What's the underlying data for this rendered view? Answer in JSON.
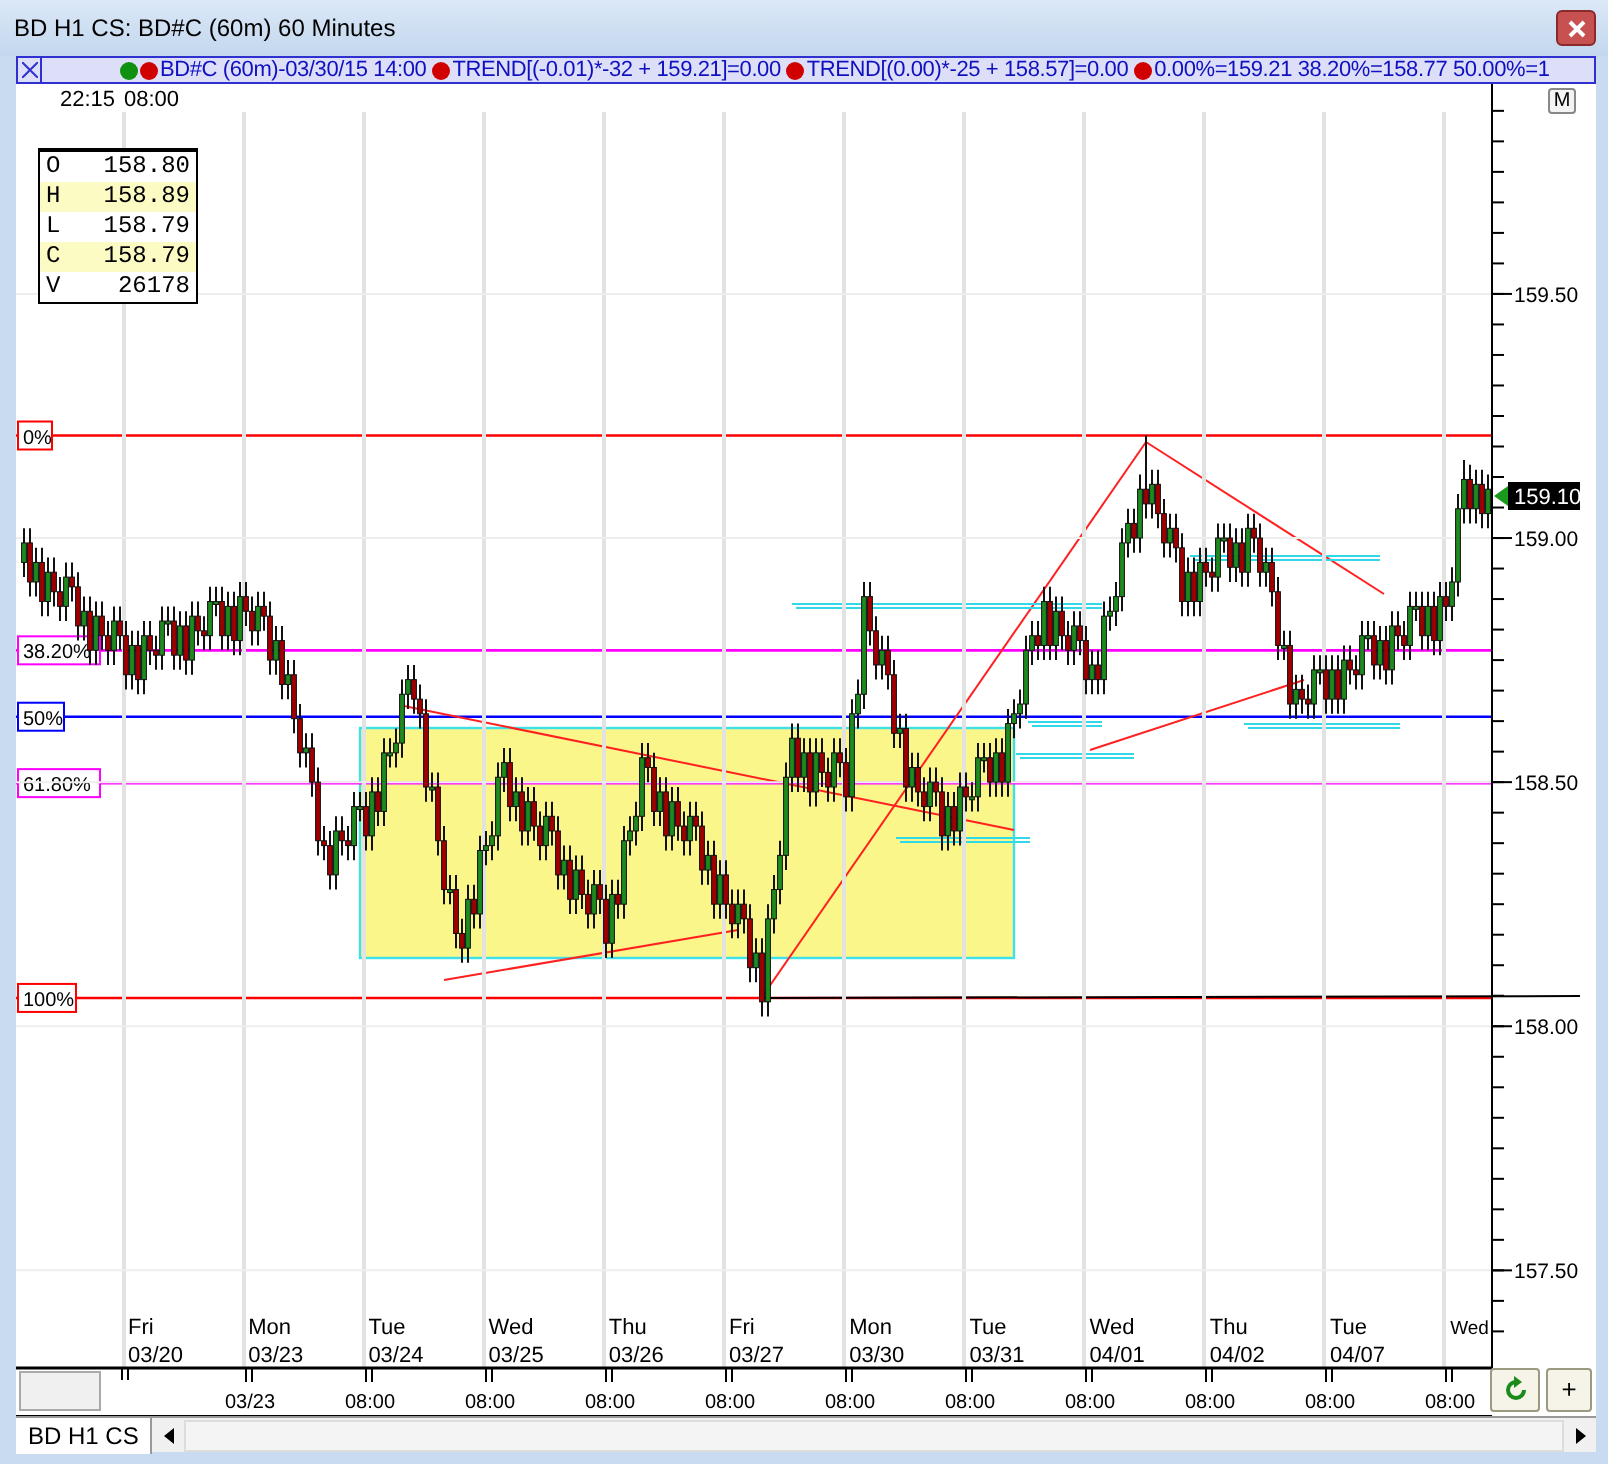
{
  "window": {
    "title": "BD H1 CS: BD#C (60m) 60 Minutes"
  },
  "legend": [
    {
      "kind": "symbol",
      "text": "BD#C (60m)-03/30/15 14:00"
    },
    {
      "kind": "study",
      "text": "TREND[(-0.01)*-32 + 159.21]=0.00"
    },
    {
      "kind": "study",
      "text": "TREND[(0.00)*-25 + 158.57]=0.00"
    },
    {
      "kind": "study",
      "text": "0.00%=159.21 38.20%=158.77 50.00%=1"
    }
  ],
  "time_header": [
    "22:15",
    "08:00"
  ],
  "fib_levels": [
    {
      "label": "0%",
      "color": "#ff0000"
    },
    {
      "label": "38.20%",
      "color": "#ff00ff"
    },
    {
      "label": "50%",
      "color": "#0000ff"
    },
    {
      "label": "61.80%",
      "color": "#ff00ff"
    },
    {
      "label": "100%",
      "color": "#ff0000"
    }
  ],
  "corner_button": "M",
  "ohlc": [
    {
      "label": "O",
      "value": "158.80",
      "highlighted": false
    },
    {
      "label": "H",
      "value": "158.89",
      "highlighted": true
    },
    {
      "label": "L",
      "value": "158.79",
      "highlighted": false
    },
    {
      "label": "C",
      "value": "158.79",
      "highlighted": true
    },
    {
      "label": "V",
      "value": "26178",
      "highlighted": false
    }
  ],
  "last_price": "159.10",
  "date_labels": [
    {
      "day": "Fri",
      "date": "03/20"
    },
    {
      "day": "Mon",
      "date": "03/23"
    },
    {
      "day": "Tue",
      "date": "03/24"
    },
    {
      "day": "Wed",
      "date": "03/25"
    },
    {
      "day": "Thu",
      "date": "03/26"
    },
    {
      "day": "Fri",
      "date": "03/27"
    },
    {
      "day": "Mon",
      "date": "03/30"
    },
    {
      "day": "Tue",
      "date": "03/31"
    },
    {
      "day": "Wed",
      "date": "04/01"
    },
    {
      "day": "Thu",
      "date": "04/02"
    },
    {
      "day": "Tue",
      "date": "04/07"
    },
    {
      "day": "Wed"
    }
  ],
  "time_axis": [
    "03/23",
    "08:00",
    "08:00",
    "08:00",
    "08:00",
    "08:00",
    "08:00",
    "08:00",
    "08:00",
    "08:00",
    "08:00"
  ],
  "chart": {
    "chart_data": {
      "type": "candlestick",
      "ylim": [
        157.3,
        159.93
      ],
      "grid": true,
      "yticks": [
        {
          "value": 159.5,
          "label": "159.50"
        },
        {
          "value": 159.0,
          "label": "159.00"
        },
        {
          "value": 158.5,
          "label": "158.50"
        },
        {
          "value": 158.0,
          "label": "158.00"
        },
        {
          "value": 157.5,
          "label": "157.50"
        }
      ],
      "categories": [
        null,
        null,
        null,
        null,
        null,
        null,
        null,
        null,
        null,
        null,
        null,
        null,
        null,
        null,
        null,
        null,
        null,
        null,
        null,
        null,
        null,
        null,
        null,
        null,
        null,
        null,
        null,
        null,
        null,
        null,
        null,
        null,
        null,
        null,
        null,
        null,
        null,
        null,
        null,
        null,
        null,
        null,
        null,
        null,
        null,
        null,
        null,
        null,
        null,
        null,
        null,
        null,
        null,
        null,
        null,
        null,
        null,
        null,
        null,
        null,
        null,
        null,
        null,
        null,
        null,
        null,
        null,
        null,
        null,
        null,
        null,
        null,
        null,
        null,
        null,
        null,
        null,
        null,
        null,
        null,
        null,
        null,
        null,
        null,
        null,
        null,
        null,
        null,
        null,
        null,
        null,
        null,
        null,
        null,
        null,
        null,
        null,
        null,
        null,
        null,
        null,
        null,
        null,
        null,
        null,
        null,
        null,
        null,
        null,
        null,
        null,
        null,
        null,
        null,
        null,
        null,
        null,
        null,
        null,
        null,
        null,
        null,
        null,
        null,
        null,
        null,
        null,
        null,
        null,
        null,
        null,
        null,
        null,
        null,
        null,
        null,
        null,
        null,
        null,
        null,
        null,
        null,
        null,
        null,
        null,
        null,
        null,
        null,
        null,
        null,
        null,
        null,
        null,
        null,
        null,
        null,
        null,
        null,
        null,
        null,
        null,
        null,
        null,
        null,
        null,
        null,
        null,
        null,
        null,
        null,
        null,
        null,
        null,
        null,
        null,
        null,
        null,
        null,
        null,
        null,
        null,
        null,
        null,
        null,
        null,
        null,
        null,
        null,
        null,
        null,
        null,
        null,
        null,
        null,
        null,
        null,
        null,
        null,
        null,
        null,
        null,
        null,
        null,
        null,
        null,
        null,
        null,
        null,
        null,
        null,
        null,
        null,
        null,
        null,
        null,
        null,
        null,
        null,
        null,
        null,
        null,
        null,
        null,
        null,
        null,
        null,
        null,
        null,
        null,
        null,
        null,
        null,
        null,
        null,
        null,
        null,
        null,
        null,
        null,
        null,
        null,
        null,
        null,
        null,
        null
      ],
      "ohlc": [
        [
          158.95,
          159.02,
          158.92,
          158.99
        ],
        [
          158.99,
          159.02,
          158.88,
          158.91
        ],
        [
          158.91,
          158.98,
          158.88,
          158.95
        ],
        [
          158.95,
          158.98,
          158.84,
          158.87
        ],
        [
          158.87,
          158.96,
          158.84,
          158.93
        ],
        [
          158.93,
          158.96,
          158.86,
          158.89
        ],
        [
          158.89,
          158.92,
          158.83,
          158.86
        ],
        [
          158.86,
          158.95,
          158.83,
          158.92
        ],
        [
          158.92,
          158.95,
          158.87,
          158.9
        ],
        [
          158.9,
          158.93,
          158.79,
          158.82
        ],
        [
          158.82,
          158.88,
          158.79,
          158.85
        ],
        [
          158.85,
          158.88,
          158.74,
          158.77
        ],
        [
          158.77,
          158.87,
          158.74,
          158.84
        ],
        [
          158.84,
          158.87,
          158.77,
          158.8
        ],
        [
          158.8,
          158.83,
          158.74,
          158.77
        ],
        [
          158.77,
          158.86,
          158.74,
          158.83
        ],
        [
          158.83,
          158.86,
          158.77,
          158.8
        ],
        [
          158.8,
          158.83,
          158.69,
          158.72
        ],
        [
          158.72,
          158.81,
          158.69,
          158.78
        ],
        [
          158.78,
          158.81,
          158.68,
          158.71
        ],
        [
          158.71,
          158.83,
          158.68,
          158.8
        ],
        [
          158.8,
          158.83,
          158.74,
          158.77
        ],
        [
          158.77,
          158.8,
          158.73,
          158.76
        ],
        [
          158.76,
          158.86,
          158.73,
          158.83
        ],
        [
          158.83,
          158.86,
          158.8,
          158.83
        ],
        [
          158.83,
          158.86,
          158.73,
          158.76
        ],
        [
          158.76,
          158.85,
          158.73,
          158.82
        ],
        [
          158.82,
          158.85,
          158.72,
          158.75
        ],
        [
          158.75,
          158.87,
          158.72,
          158.84
        ],
        [
          158.84,
          158.87,
          158.78,
          158.81
        ],
        [
          158.81,
          158.84,
          158.77,
          158.8
        ],
        [
          158.8,
          158.9,
          158.77,
          158.87
        ],
        [
          158.87,
          158.9,
          158.84,
          158.87
        ],
        [
          158.87,
          158.9,
          158.77,
          158.8
        ],
        [
          158.8,
          158.89,
          158.77,
          158.86
        ],
        [
          158.86,
          158.89,
          158.76,
          158.79
        ],
        [
          158.79,
          158.91,
          158.76,
          158.88
        ],
        [
          158.88,
          158.91,
          158.82,
          158.85
        ],
        [
          158.85,
          158.88,
          158.78,
          158.81
        ],
        [
          158.81,
          158.89,
          158.78,
          158.86
        ],
        [
          158.86,
          158.89,
          158.81,
          158.84
        ],
        [
          158.84,
          158.87,
          158.72,
          158.75
        ],
        [
          158.75,
          158.82,
          158.72,
          158.79
        ],
        [
          158.79,
          158.82,
          158.67,
          158.7
        ],
        [
          158.7,
          158.75,
          158.67,
          158.72
        ],
        [
          158.72,
          158.75,
          158.6,
          158.63
        ],
        [
          158.63,
          158.66,
          158.53,
          158.56
        ],
        [
          158.56,
          158.6,
          158.53,
          158.57
        ],
        [
          158.57,
          158.6,
          158.47,
          158.5
        ],
        [
          158.5,
          158.53,
          158.35,
          158.38
        ],
        [
          158.38,
          158.41,
          158.34,
          158.37
        ],
        [
          158.37,
          158.4,
          158.28,
          158.31
        ],
        [
          158.31,
          158.43,
          158.28,
          158.4
        ],
        [
          158.4,
          158.43,
          158.35,
          158.38
        ],
        [
          158.38,
          158.41,
          158.34,
          158.37
        ],
        [
          158.37,
          158.48,
          158.34,
          158.45
        ],
        [
          158.45,
          158.48,
          158.42,
          158.45
        ],
        [
          158.45,
          158.48,
          158.36,
          158.39
        ],
        [
          158.39,
          158.51,
          158.36,
          158.48
        ],
        [
          158.48,
          158.51,
          158.41,
          158.44
        ],
        [
          158.44,
          158.59,
          158.41,
          158.56
        ],
        [
          158.56,
          158.59,
          158.53,
          158.56
        ],
        [
          158.56,
          158.61,
          158.53,
          158.58
        ],
        [
          158.58,
          158.71,
          158.55,
          158.68
        ],
        [
          158.68,
          158.74,
          158.65,
          158.71
        ],
        [
          158.71,
          158.74,
          158.64,
          158.67
        ],
        [
          158.67,
          158.7,
          158.61,
          158.64
        ],
        [
          158.64,
          158.67,
          158.46,
          158.49
        ],
        [
          158.49,
          158.52,
          158.46,
          158.49
        ],
        [
          158.49,
          158.52,
          158.35,
          158.38
        ],
        [
          158.38,
          158.41,
          158.25,
          158.28
        ],
        [
          158.28,
          158.31,
          158.25,
          158.28
        ],
        [
          158.28,
          158.31,
          158.16,
          158.19
        ],
        [
          158.19,
          158.22,
          158.13,
          158.16
        ],
        [
          158.16,
          158.29,
          158.13,
          158.26
        ],
        [
          158.26,
          158.29,
          158.2,
          158.23
        ],
        [
          158.23,
          158.39,
          158.2,
          158.36
        ],
        [
          158.36,
          158.4,
          158.33,
          158.37
        ],
        [
          158.37,
          158.42,
          158.34,
          158.39
        ],
        [
          158.39,
          158.54,
          158.36,
          158.51
        ],
        [
          158.51,
          158.57,
          158.48,
          158.54
        ],
        [
          158.54,
          158.57,
          158.42,
          158.45
        ],
        [
          158.45,
          158.51,
          158.42,
          158.48
        ],
        [
          158.48,
          158.51,
          158.37,
          158.4
        ],
        [
          158.4,
          158.49,
          158.37,
          158.46
        ],
        [
          158.46,
          158.49,
          158.38,
          158.41
        ],
        [
          158.41,
          158.44,
          158.34,
          158.37
        ],
        [
          158.37,
          158.46,
          158.34,
          158.43
        ],
        [
          158.43,
          158.46,
          158.37,
          158.4
        ],
        [
          158.4,
          158.43,
          158.28,
          158.31
        ],
        [
          158.31,
          158.37,
          158.28,
          158.34
        ],
        [
          158.34,
          158.37,
          158.23,
          158.26
        ],
        [
          158.26,
          158.35,
          158.23,
          158.32
        ],
        [
          158.32,
          158.35,
          158.24,
          158.27
        ],
        [
          158.27,
          158.3,
          158.2,
          158.23
        ],
        [
          158.23,
          158.32,
          158.2,
          158.29
        ],
        [
          158.29,
          158.32,
          158.23,
          158.26
        ],
        [
          158.26,
          158.29,
          158.14,
          158.17
        ],
        [
          158.17,
          158.3,
          158.14,
          158.27
        ],
        [
          158.27,
          158.3,
          158.22,
          158.25
        ],
        [
          158.25,
          158.41,
          158.22,
          158.38
        ],
        [
          158.38,
          158.43,
          158.35,
          158.4
        ],
        [
          158.4,
          158.46,
          158.37,
          158.43
        ],
        [
          158.43,
          158.58,
          158.4,
          158.55
        ],
        [
          158.55,
          158.58,
          158.5,
          158.53
        ],
        [
          158.53,
          158.56,
          158.41,
          158.44
        ],
        [
          158.44,
          158.51,
          158.41,
          158.48
        ],
        [
          158.48,
          158.51,
          158.36,
          158.39
        ],
        [
          158.39,
          158.49,
          158.36,
          158.46
        ],
        [
          158.46,
          158.49,
          158.38,
          158.41
        ],
        [
          158.41,
          158.44,
          158.35,
          158.38
        ],
        [
          158.38,
          158.46,
          158.35,
          158.43
        ],
        [
          158.43,
          158.46,
          158.38,
          158.41
        ],
        [
          158.41,
          158.44,
          158.29,
          158.32
        ],
        [
          158.32,
          158.38,
          158.29,
          158.35
        ],
        [
          158.35,
          158.38,
          158.22,
          158.25
        ],
        [
          158.25,
          158.34,
          158.22,
          158.31
        ],
        [
          158.31,
          158.34,
          158.22,
          158.25
        ],
        [
          158.25,
          158.28,
          158.18,
          158.21
        ],
        [
          158.21,
          158.28,
          158.18,
          158.25
        ],
        [
          158.25,
          158.28,
          158.19,
          158.22
        ],
        [
          158.22,
          158.25,
          158.09,
          158.12
        ],
        [
          158.12,
          158.18,
          158.09,
          158.15
        ],
        [
          158.15,
          158.18,
          158.02,
          158.05
        ],
        [
          158.05,
          158.25,
          158.02,
          158.22
        ],
        [
          158.22,
          158.31,
          158.19,
          158.28
        ],
        [
          158.28,
          158.38,
          158.25,
          158.35
        ],
        [
          158.35,
          158.54,
          158.32,
          158.51
        ],
        [
          158.51,
          158.62,
          158.48,
          158.59
        ],
        [
          158.59,
          158.62,
          158.48,
          158.51
        ],
        [
          158.51,
          158.59,
          158.48,
          158.56
        ],
        [
          158.56,
          158.59,
          158.45,
          158.48
        ],
        [
          158.48,
          158.59,
          158.45,
          158.56
        ],
        [
          158.56,
          158.59,
          158.49,
          158.52
        ],
        [
          158.52,
          158.55,
          158.46,
          158.49
        ],
        [
          158.49,
          158.59,
          158.46,
          158.56
        ],
        [
          158.56,
          158.59,
          158.51,
          158.54
        ],
        [
          158.54,
          158.57,
          158.44,
          158.47
        ],
        [
          158.47,
          158.67,
          158.44,
          158.64
        ],
        [
          158.64,
          158.71,
          158.61,
          158.68
        ],
        [
          158.68,
          158.91,
          158.65,
          158.88
        ],
        [
          158.88,
          158.91,
          158.78,
          158.81
        ],
        [
          158.81,
          158.84,
          158.71,
          158.74
        ],
        [
          158.74,
          158.8,
          158.71,
          158.77
        ],
        [
          158.77,
          158.8,
          158.69,
          158.72
        ],
        [
          158.72,
          158.75,
          158.57,
          158.6
        ],
        [
          158.6,
          158.64,
          158.57,
          158.61
        ],
        [
          158.61,
          158.64,
          158.46,
          158.49
        ],
        [
          158.49,
          158.56,
          158.46,
          158.53
        ],
        [
          158.53,
          158.56,
          158.45,
          158.48
        ],
        [
          158.48,
          158.51,
          158.42,
          158.45
        ],
        [
          158.45,
          158.53,
          158.42,
          158.5
        ],
        [
          158.5,
          158.53,
          158.45,
          158.48
        ],
        [
          158.48,
          158.51,
          158.36,
          158.39
        ],
        [
          158.39,
          158.48,
          158.36,
          158.45
        ],
        [
          158.45,
          158.48,
          158.37,
          158.4
        ],
        [
          158.4,
          158.52,
          158.37,
          158.49
        ],
        [
          158.49,
          158.52,
          158.44,
          158.47
        ],
        [
          158.47,
          158.5,
          158.44,
          158.47
        ],
        [
          158.47,
          158.58,
          158.44,
          158.55
        ],
        [
          158.55,
          158.58,
          158.52,
          158.55
        ],
        [
          158.55,
          158.58,
          158.47,
          158.5
        ],
        [
          158.5,
          158.59,
          158.47,
          158.56
        ],
        [
          158.56,
          158.59,
          158.47,
          158.5
        ],
        [
          158.5,
          158.65,
          158.47,
          158.62
        ],
        [
          158.62,
          158.67,
          158.59,
          158.64
        ],
        [
          158.64,
          158.69,
          158.61,
          158.66
        ],
        [
          158.66,
          158.8,
          158.63,
          158.77
        ],
        [
          158.77,
          158.83,
          158.74,
          158.8
        ],
        [
          158.8,
          158.83,
          158.75,
          158.78
        ],
        [
          158.78,
          158.9,
          158.75,
          158.87
        ],
        [
          158.87,
          158.9,
          158.75,
          158.78
        ],
        [
          158.78,
          158.88,
          158.75,
          158.85
        ],
        [
          158.85,
          158.88,
          158.77,
          158.8
        ],
        [
          158.8,
          158.83,
          158.74,
          158.77
        ],
        [
          158.77,
          158.85,
          158.74,
          158.82
        ],
        [
          158.82,
          158.85,
          158.76,
          158.79
        ],
        [
          158.79,
          158.82,
          158.68,
          158.71
        ],
        [
          158.71,
          158.77,
          158.68,
          158.74
        ],
        [
          158.74,
          158.77,
          158.68,
          158.71
        ],
        [
          158.71,
          158.87,
          158.68,
          158.84
        ],
        [
          158.84,
          158.88,
          158.81,
          158.85
        ],
        [
          158.85,
          158.91,
          158.82,
          158.88
        ],
        [
          158.88,
          159.02,
          158.85,
          158.99
        ],
        [
          158.99,
          159.06,
          158.96,
          159.03
        ],
        [
          159.03,
          159.06,
          158.97,
          159.0
        ],
        [
          159.0,
          159.13,
          158.97,
          159.1
        ],
        [
          159.1,
          159.21,
          159.04,
          159.07
        ],
        [
          159.07,
          159.14,
          159.04,
          159.11
        ],
        [
          159.11,
          159.14,
          159.02,
          159.05
        ],
        [
          159.05,
          159.08,
          158.96,
          158.99
        ],
        [
          158.99,
          159.05,
          158.96,
          159.02
        ],
        [
          159.02,
          159.05,
          158.95,
          158.98
        ],
        [
          158.98,
          159.01,
          158.84,
          158.87
        ],
        [
          158.87,
          158.96,
          158.84,
          158.93
        ],
        [
          158.93,
          158.96,
          158.84,
          158.87
        ],
        [
          158.87,
          158.98,
          158.84,
          158.95
        ],
        [
          158.95,
          158.98,
          158.9,
          158.93
        ],
        [
          158.93,
          158.96,
          158.89,
          158.92
        ],
        [
          158.92,
          159.03,
          158.89,
          159.0
        ],
        [
          159.0,
          159.03,
          158.97,
          159.0
        ],
        [
          159.0,
          159.03,
          158.91,
          158.94
        ],
        [
          158.94,
          159.02,
          158.91,
          158.99
        ],
        [
          158.99,
          159.02,
          158.9,
          158.93
        ],
        [
          158.93,
          159.05,
          158.9,
          159.02
        ],
        [
          159.02,
          159.05,
          158.97,
          159.0
        ],
        [
          159.0,
          159.03,
          158.9,
          158.93
        ],
        [
          158.93,
          158.98,
          158.9,
          158.95
        ],
        [
          158.95,
          158.98,
          158.86,
          158.89
        ],
        [
          158.89,
          158.92,
          158.75,
          158.78
        ],
        [
          158.78,
          158.81,
          158.75,
          158.78
        ],
        [
          158.78,
          158.81,
          158.63,
          158.66
        ],
        [
          158.66,
          158.72,
          158.63,
          158.69
        ],
        [
          158.69,
          158.72,
          158.64,
          158.67
        ],
        [
          158.67,
          158.7,
          158.63,
          158.66
        ],
        [
          158.66,
          158.76,
          158.63,
          158.73
        ],
        [
          158.73,
          158.76,
          158.7,
          158.73
        ],
        [
          158.73,
          158.76,
          158.64,
          158.67
        ],
        [
          158.67,
          158.76,
          158.64,
          158.73
        ],
        [
          158.73,
          158.76,
          158.64,
          158.67
        ],
        [
          158.67,
          158.78,
          158.64,
          158.75
        ],
        [
          158.75,
          158.78,
          158.7,
          158.73
        ],
        [
          158.73,
          158.76,
          158.69,
          158.72
        ],
        [
          158.72,
          158.83,
          158.69,
          158.8
        ],
        [
          158.8,
          158.83,
          158.77,
          158.8
        ],
        [
          158.8,
          158.83,
          158.71,
          158.74
        ],
        [
          158.74,
          158.82,
          158.71,
          158.79
        ],
        [
          158.79,
          158.82,
          158.7,
          158.73
        ],
        [
          158.73,
          158.85,
          158.7,
          158.82
        ],
        [
          158.82,
          158.85,
          158.77,
          158.8
        ],
        [
          158.8,
          158.83,
          158.75,
          158.78
        ],
        [
          158.78,
          158.89,
          158.75,
          158.86
        ],
        [
          158.86,
          158.89,
          158.83,
          158.86
        ],
        [
          158.86,
          158.89,
          158.77,
          158.8
        ],
        [
          158.8,
          158.89,
          158.77,
          158.86
        ],
        [
          158.86,
          158.89,
          158.76,
          158.79
        ],
        [
          158.79,
          158.91,
          158.76,
          158.88
        ],
        [
          158.88,
          158.91,
          158.83,
          158.86
        ],
        [
          158.86,
          158.94,
          158.83,
          158.91
        ],
        [
          158.91,
          159.09,
          158.88,
          159.06
        ],
        [
          159.06,
          159.16,
          159.03,
          159.12
        ],
        [
          159.12,
          159.15,
          159.03,
          159.06
        ],
        [
          159.06,
          159.14,
          159.03,
          159.11
        ],
        [
          159.11,
          159.14,
          159.02,
          159.05
        ],
        [
          159.05,
          159.13,
          159.02,
          159.1
        ]
      ]
    }
  },
  "plus_button": "+",
  "sheet_tab": "BD H1 CS"
}
